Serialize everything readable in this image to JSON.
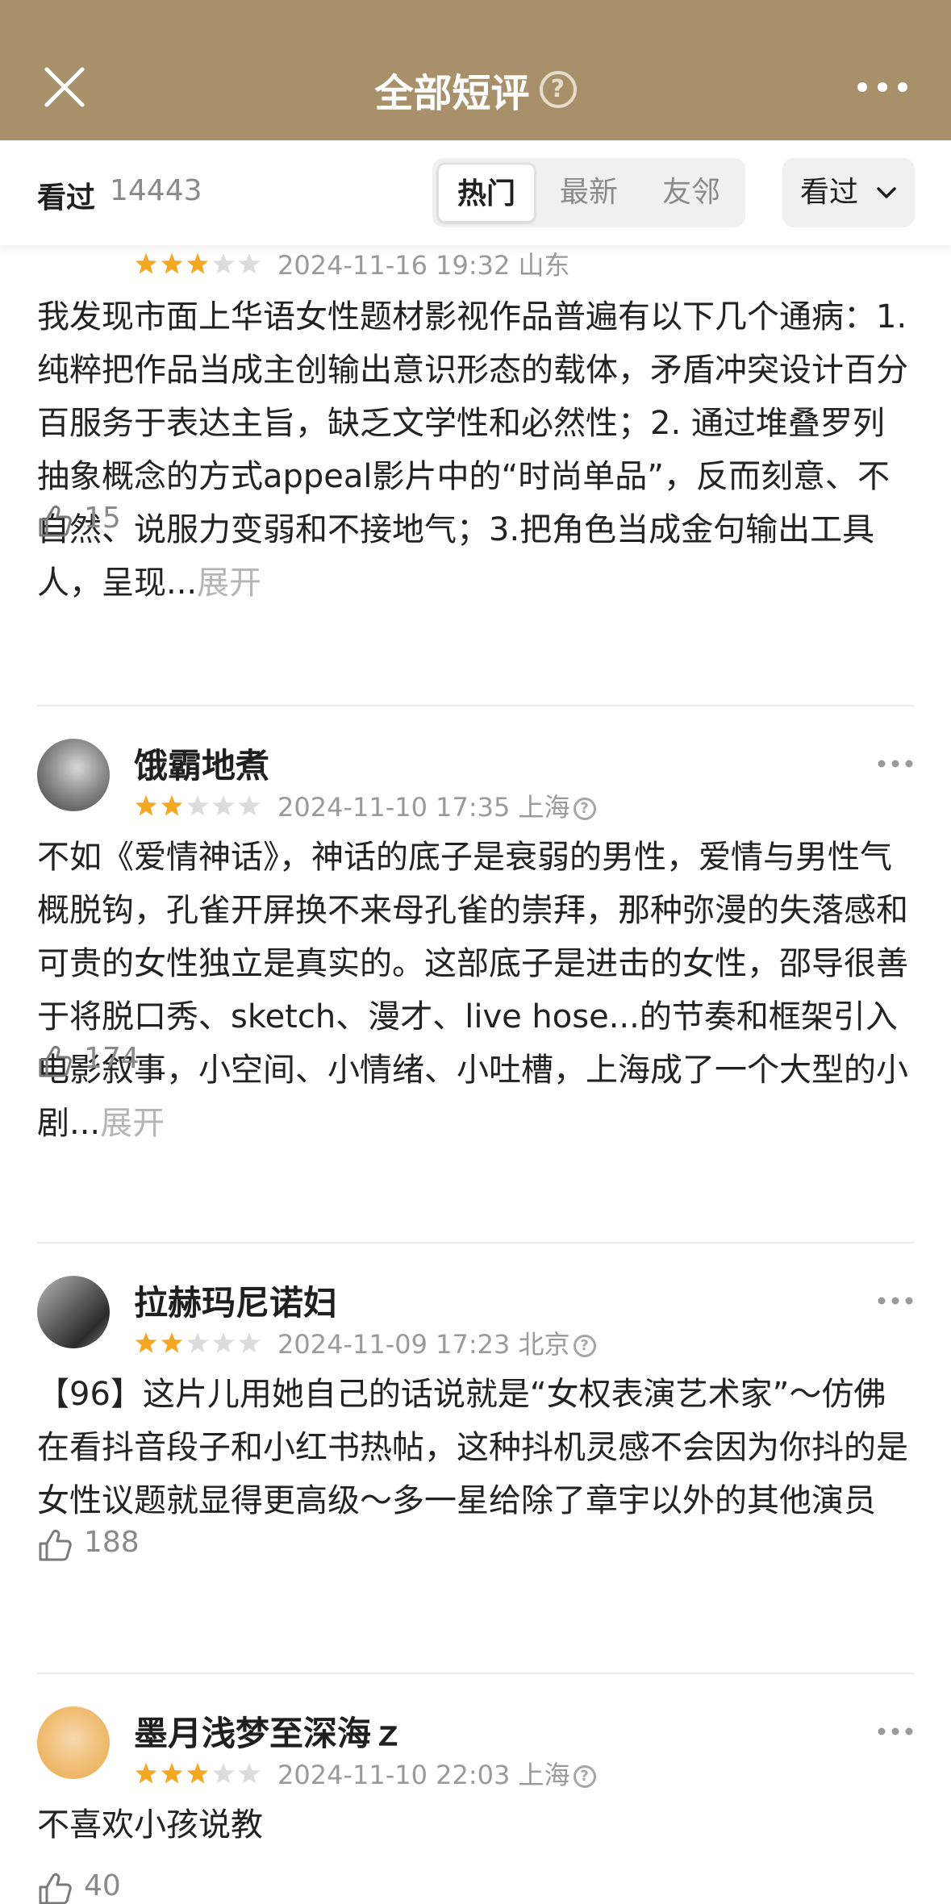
{
  "header": {
    "title": "全部短评",
    "help_label": "?",
    "close_icon": "close-icon",
    "more_icon": "more-horizontal-icon"
  },
  "filter": {
    "seen_label": "看过",
    "seen_count": "14443",
    "tabs": [
      {
        "label": "热门",
        "active": true
      },
      {
        "label": "最新",
        "active": false
      },
      {
        "label": "友邻",
        "active": false
      }
    ],
    "status_filter": "看过"
  },
  "colors": {
    "header_bg": "#a8916a",
    "star_filled": "#f5a623",
    "star_empty": "#dcdcdc"
  },
  "comments": [
    {
      "username": "",
      "rating": 3,
      "meta": "2024-11-16 19:32 山东",
      "show_help": false,
      "text": "我发现市面上华语女性题材影视作品普遍有以下几个通病：1.纯粹把作品当成主创输出意识形态的载体，矛盾冲突设计百分百服务于表达主旨，缺乏文学性和必然性；2. 通过堆叠罗列抽象概念的方式appeal影片中的“时尚单品”，反而刻意、不自然、说服力变弱和不接地气；3.把角色当成金句输出工具人，呈现...",
      "expand": "展开",
      "likes": "15"
    },
    {
      "username": "饿霸地煮",
      "rating": 2,
      "meta": "2024-11-10 17:35 上海",
      "show_help": true,
      "text": "不如《爱情神话》，神话的底子是衰弱的男性，爱情与男性气概脱钩，孔雀开屏换不来母孔雀的崇拜，那种弥漫的失落感和可贵的女性独立是真实的。这部底子是进击的女性，邵导很善于将脱口秀、sketch、漫才、live hose...的节奏和框架引入电影叙事，小空间、小情绪、小吐槽，上海成了一个大型的小剧...",
      "expand": "展开",
      "likes": "174"
    },
    {
      "username": "拉赫玛尼诺妇",
      "rating": 2,
      "meta": "2024-11-09 17:23 北京",
      "show_help": true,
      "text": "【96】这片儿用她自己的话说就是“女权表演艺术家”～仿佛在看抖音段子和小红书热帖，这种抖机灵感不会因为你抖的是女性议题就显得更高级～多一星给除了章宇以外的其他演员",
      "expand": "",
      "likes": "188"
    },
    {
      "username": "墨月浅梦至深海ｚ",
      "rating": 3,
      "meta": "2024-11-10 22:03 上海",
      "show_help": true,
      "text": "不喜欢小孩说教",
      "expand": "",
      "likes": "40"
    }
  ]
}
